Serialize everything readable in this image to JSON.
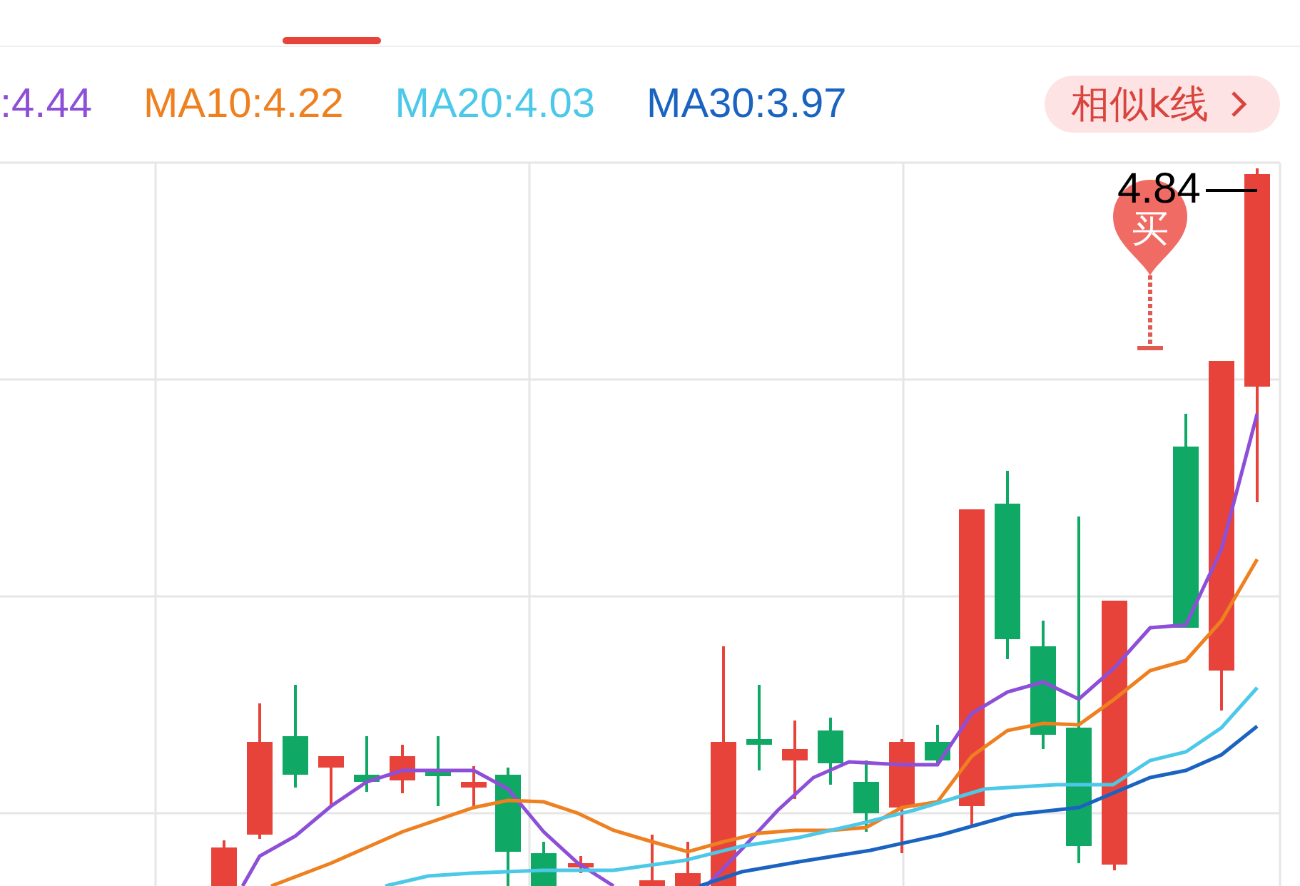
{
  "legend": [
    {
      "label": ":4.44",
      "color": "#8e4fd8"
    },
    {
      "label": "MA10:4.22",
      "color": "#ee8020"
    },
    {
      "label": "MA20:4.03",
      "color": "#4cc8e8"
    },
    {
      "label": "MA30:3.97",
      "color": "#1a63c0"
    }
  ],
  "similar_button": {
    "label": "相似k线"
  },
  "chart": {
    "price_label": "4.84",
    "marker": {
      "label": "买"
    }
  }
}
